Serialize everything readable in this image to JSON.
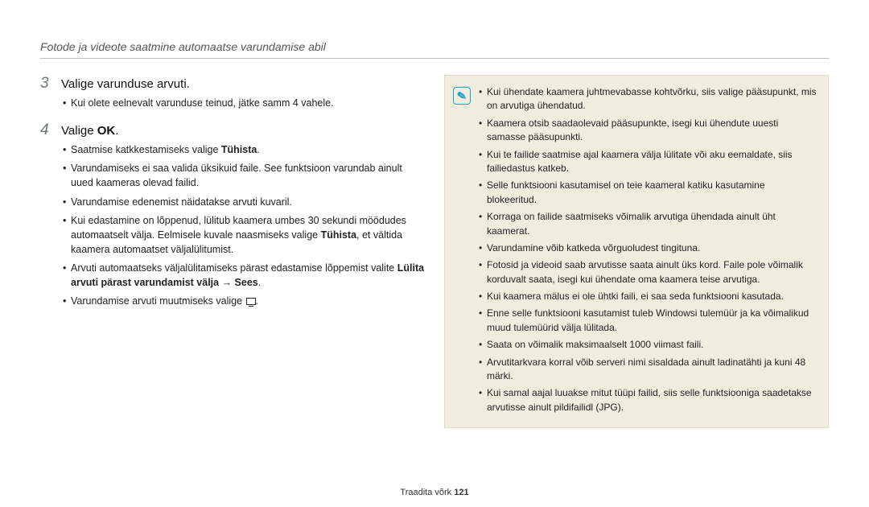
{
  "header": "Fotode ja videote saatmine automaatse varundamise abil",
  "steps": [
    {
      "num": "3",
      "title": "Valige varunduse arvuti.",
      "bullets": [
        {
          "text": "Kui olete eelnevalt varunduse teinud, jätke samm 4 vahele."
        }
      ]
    },
    {
      "num": "4",
      "title_pre": "Valige ",
      "title_strong": "OK",
      "title_post": ".",
      "bullets": [
        {
          "pre": "Saatmise katkkestamiseks valige ",
          "strong": "Tühista",
          "post": "."
        },
        {
          "text": "Varundamiseks ei saa valida üksikuid faile. See funktsioon varundab ainult uued kaameras olevad failid."
        },
        {
          "text": "Varundamise edenemist näidatakse arvuti kuvaril."
        },
        {
          "pre": "Kui edastamine on lõppenud, lülitub kaamera umbes 30 sekundi möödudes automaatselt välja. Eelmisele kuvale naasmiseks valige ",
          "strong": "Tühista",
          "post": ", et vältida kaamera automaatset väljalülitumist."
        },
        {
          "pre": "Arvuti automaatseks väljalülitamiseks pärast edastamise lõppemist valite ",
          "strong": "Lülita arvuti pärast varundamist välja → Sees",
          "post": "."
        },
        {
          "text": "Varundamise arvuti muutmiseks valige ",
          "icon": true,
          "post2": "."
        }
      ]
    }
  ],
  "notes": [
    "Kui ühendate kaamera juhtmevabasse kohtvõrku, siis valige pääsupunkt, mis on arvutiga ühendatud.",
    "Kaamera otsib saadaolevaid pääsupunkte, isegi kui ühendute uuesti samasse pääsupunkti.",
    "Kui te failide saatmise ajal kaamera välja lülitate või aku eemaldate, siis failiedastus katkeb.",
    "Selle funktsiooni kasutamisel on teie kaameral katiku kasutamine blokeeritud.",
    "Korraga on failide saatmiseks võimalik arvutiga ühendada ainult üht kaamerat.",
    "Varundamine võib katkeda võrguoludest tingituna.",
    "Fotosid ja videoid saab arvutisse saata ainult üks kord. Faile pole võimalik korduvalt saata, isegi kui ühendate oma kaamera teise arvutiga.",
    "Kui kaamera mälus ei ole ühtki faili, ei saa seda funktsiooni kasutada.",
    "Enne selle funktsiooni kasutamist tuleb Windowsi tulemüür ja ka võimalikud muud tulemüürid välja lülitada.",
    "Saata on võimalik maksimaalselt 1000 viimast faili.",
    "Arvutitarkvara korral võib serveri nimi sisaldada ainult ladinatähti ja kuni 48 märki.",
    "Kui samal aajal luuakse mitut tüüpi failid, siis selle funktsiooniga saadetakse arvutisse ainult pildifailidl (JPG)."
  ],
  "footer_pre": "Traadita võrk  ",
  "footer_num": "121"
}
